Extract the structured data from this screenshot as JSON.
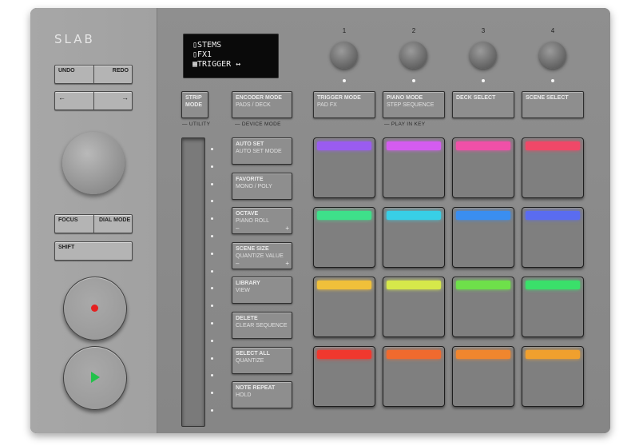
{
  "brand": {
    "logo": "SLAB"
  },
  "left": {
    "undo": "UNDO",
    "redo": "REDO",
    "left_arrow": "←",
    "right_arrow": "→",
    "focus": "FOCUS",
    "dial_mode": "DIAL MODE",
    "shift": "SHIFT",
    "record_color": "#e52020",
    "play_color": "#22c24a"
  },
  "oled": {
    "lines": [
      "▯STEMS",
      "▯FX1",
      "▦TRIGGER ↔"
    ]
  },
  "encoders": {
    "numbers": [
      "1",
      "2",
      "3",
      "4"
    ]
  },
  "mode_buttons": {
    "strip_mode": {
      "title": "STRIP MODE",
      "sub": ""
    },
    "encoder_mode": {
      "title": "ENCODER MODE",
      "sub": "PADS / DECK"
    },
    "trigger_mode": {
      "title": "TRIGGER MODE",
      "sub": "PAD FX"
    },
    "piano_mode": {
      "title": "PIANO MODE",
      "sub": "STEP SEQUENCE"
    },
    "deck_select": {
      "title": "DECK SELECT",
      "sub": ""
    },
    "scene_select": {
      "title": "SCENE SELECT",
      "sub": ""
    }
  },
  "sublabels": {
    "utility": "— UTILITY",
    "device_mode": "— DEVICE MODE",
    "play_in_key": "— PLAY IN KEY"
  },
  "function_buttons": [
    {
      "title": "AUTO SET",
      "sub": "AUTO SET MODE",
      "minus": "",
      "plus": ""
    },
    {
      "title": "FAVORITE",
      "sub": "MONO / POLY",
      "minus": "",
      "plus": ""
    },
    {
      "title": "OCTAVE",
      "sub": "PIANO ROLL",
      "minus": "–",
      "plus": "+"
    },
    {
      "title": "SCENE SIZE",
      "sub": "QUANTIZE VALUE",
      "minus": "–",
      "plus": "+"
    },
    {
      "title": "LIBRARY",
      "sub": "VIEW",
      "minus": "",
      "plus": ""
    },
    {
      "title": "DELETE",
      "sub": "CLEAR SEQUENCE",
      "minus": "",
      "plus": ""
    },
    {
      "title": "SELECT ALL",
      "sub": "QUANTIZE",
      "minus": "",
      "plus": ""
    },
    {
      "title": "NOTE REPEAT",
      "sub": "HOLD",
      "minus": "",
      "plus": ""
    }
  ],
  "pads": {
    "rows": [
      [
        "#9a5cf0",
        "#d45cf0",
        "#f050a8",
        "#f04868"
      ],
      [
        "#3ee08a",
        "#38cfe6",
        "#3a8ef0",
        "#5a6cf0"
      ],
      [
        "#f0c03a",
        "#d6e84a",
        "#6ee04a",
        "#3ae06a"
      ],
      [
        "#f0382e",
        "#f06a2e",
        "#f0862e",
        "#f0a02e"
      ]
    ]
  }
}
